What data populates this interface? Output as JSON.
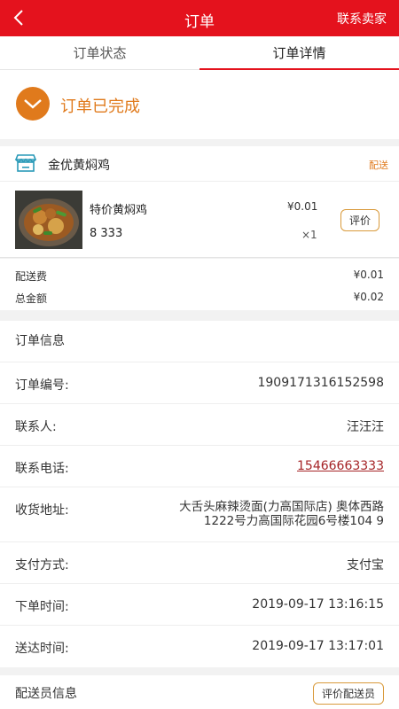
{
  "header": {
    "title": "订单",
    "contact_label": "联系卖家"
  },
  "tabs": [
    {
      "label": "订单状态"
    },
    {
      "label": "订单详情"
    }
  ],
  "status": {
    "text": "订单已完成"
  },
  "shop": {
    "name": "金优黄焖鸡",
    "delivery_tag": "配送",
    "item": {
      "name": "特价黄焖鸡",
      "price": "¥0.01",
      "sub": "8 333",
      "qty": "×1",
      "rate_label": "评价"
    }
  },
  "fees": {
    "delivery_label": "配送费",
    "delivery_value": "¥0.01",
    "total_label": "总金额",
    "total_value": "¥0.02"
  },
  "order_info": {
    "title": "订单信息",
    "rows": [
      {
        "label": "订单编号:",
        "value": "1909171316152598"
      },
      {
        "label": "联系人:",
        "value": "汪汪汪"
      },
      {
        "label": "联系电话:",
        "value": "15466663333"
      },
      {
        "label": "收货地址:",
        "value_line1": "大舌头麻辣烫面(力高国际店) 奥体西路",
        "value_line2": "1222号力高国际花园6号楼104 9"
      },
      {
        "label": "支付方式:",
        "value": "支付宝"
      },
      {
        "label": "下单时间:",
        "value": "2019-09-17 13:16:15"
      },
      {
        "label": "送达时间:",
        "value": "2019-09-17 13:17:01"
      }
    ]
  },
  "courier": {
    "title": "配送员信息",
    "rate_label": "评价配送员"
  },
  "colors": {
    "brand_red": "#e4121d",
    "accent_orange": "#e07a1c",
    "phone_link": "#a52326"
  }
}
